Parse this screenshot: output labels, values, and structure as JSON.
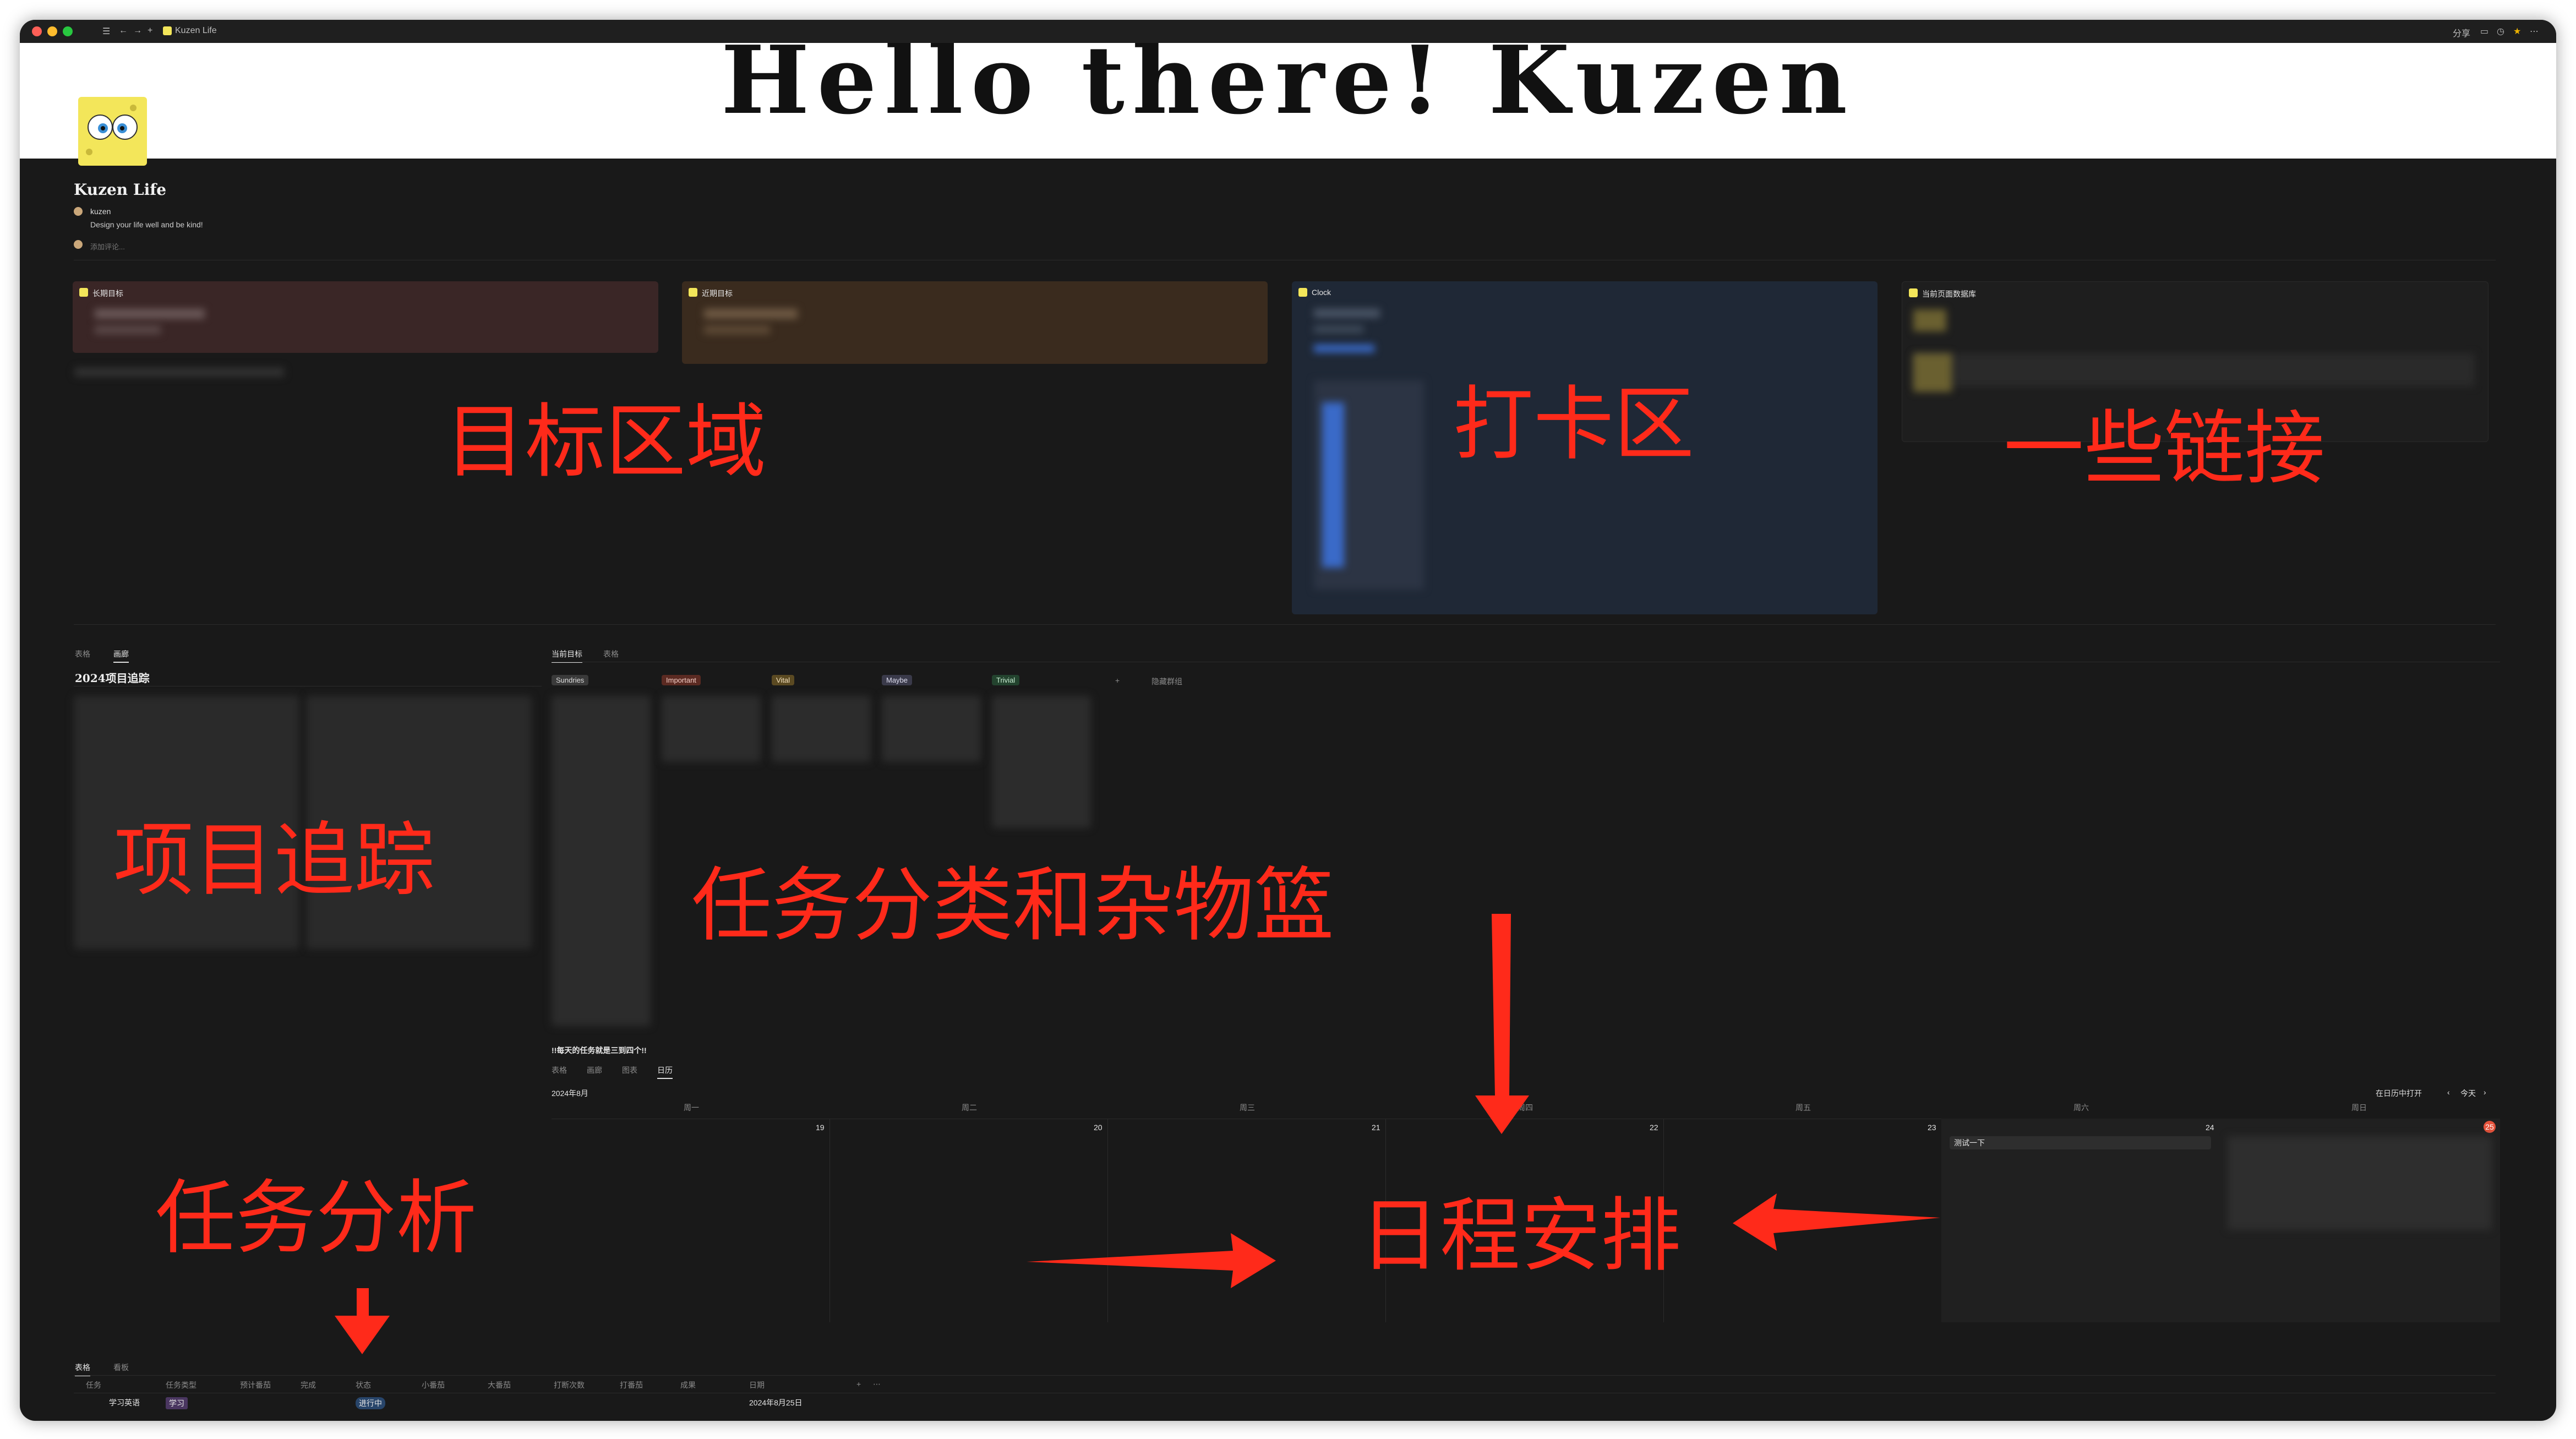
{
  "window": {
    "tab_title": "Kuzen Life",
    "top_right_share": "分享"
  },
  "cover": {
    "text": "Hello there! Kuzen"
  },
  "page": {
    "title": "Kuzen Life",
    "author": "kuzen",
    "motto": "Design your life well and be kind!",
    "comment_placeholder": "添加评论..."
  },
  "widgets": [
    {
      "title": "长期目标"
    },
    {
      "title": "近期目标"
    },
    {
      "title": "Clock"
    },
    {
      "title": "当前页面数据库"
    }
  ],
  "project_tracker": {
    "tabs": [
      "表格",
      "画廊"
    ],
    "title": "2024项目追踪"
  },
  "task_board": {
    "tabs": [
      "当前目标",
      "表格"
    ],
    "columns": [
      "Sundries",
      "Important",
      "Vital",
      "Maybe",
      "Trivial"
    ],
    "hidden_label": "隐藏群组",
    "footer_note": "!!每天的任务就是三到四个!!"
  },
  "calendar": {
    "tabs": [
      "表格",
      "画廊",
      "图表",
      "日历"
    ],
    "month": "2024年8月",
    "open_in": "在日历中打开",
    "today": "今天",
    "weekdays": [
      "周一",
      "周二",
      "周三",
      "周四",
      "周五",
      "周六",
      "周日"
    ],
    "dates": [
      "19",
      "20",
      "21",
      "22",
      "23",
      "24",
      "25"
    ],
    "event": "测试一下"
  },
  "task_analysis": {
    "tabs": [
      "表格",
      "看板"
    ],
    "headers": [
      "任务",
      "任务类型",
      "预计番茄",
      "完成",
      "状态",
      "小番茄",
      "大番茄",
      "打断次数",
      "打番茄",
      "成果",
      "日期"
    ],
    "row": {
      "name": "学习英语",
      "type": "学习",
      "status": "进行中",
      "date": "2024年8月25日"
    }
  },
  "annotations": {
    "goals": "目标区域",
    "checkin": "打卡区",
    "links": "一些链接",
    "projects": "项目追踪",
    "tasks": "任务分类和杂物篮",
    "schedule": "日程安排",
    "analysis": "任务分析"
  },
  "colors": {
    "annotation": "#ff2a1a",
    "background": "#191919",
    "goal_long": "#3a2626",
    "goal_short": "#3a2b1e",
    "clock": "#1f2836"
  }
}
